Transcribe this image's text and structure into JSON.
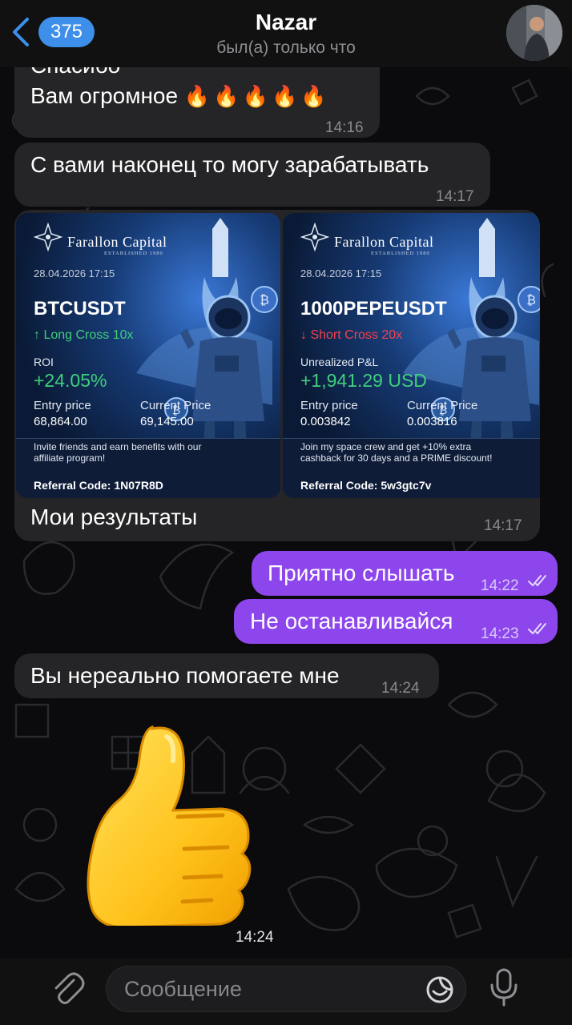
{
  "header": {
    "back_count": "375",
    "name": "Nazar",
    "status": "был(а) только что"
  },
  "messages": [
    {
      "id": "m1",
      "direction": "incoming",
      "text_cut": "Спасибо",
      "text": "Вам огромное",
      "emoji": "🔥🔥🔥🔥🔥",
      "time": "14:16"
    },
    {
      "id": "m2",
      "direction": "incoming",
      "text": "С вами наконец то могу зарабатывать",
      "time": "14:17"
    },
    {
      "id": "m3",
      "direction": "incoming",
      "text": "Мои результаты",
      "time": "14:17"
    },
    {
      "id": "m4",
      "direction": "outgoing",
      "text": "Приятно слышать",
      "time": "14:22",
      "read": true
    },
    {
      "id": "m5",
      "direction": "outgoing",
      "text": "Не останавливайся",
      "time": "14:23",
      "read": true
    },
    {
      "id": "m6",
      "direction": "incoming",
      "text": "Вы нереально помогаете мне",
      "time": "14:24"
    },
    {
      "id": "m7",
      "direction": "incoming",
      "emoji": "👍",
      "time": "14:24"
    }
  ],
  "cards": [
    {
      "brand": "Farallon Capital",
      "brand_sub": "ESTABLISHED 1980",
      "date": "28.04.2026 17:15",
      "symbol": "BTCUSDT",
      "direction": "↑ Long   Cross 10x",
      "direction_color": "#3fcf7b",
      "metric_label": "ROI",
      "metric_value": "+24.05%",
      "entry_label": "Entry price",
      "entry_value": "68,864.00",
      "current_label": "Current Price",
      "current_value": "69,145.00",
      "footer": "Invite friends and earn benefits with our affiliate program!",
      "referral": "Referral Code: 1N07R8D"
    },
    {
      "brand": "Farallon Capital",
      "brand_sub": "ESTABLISHED 1980",
      "date": "28.04.2026 17:15",
      "symbol": "1000PEPEUSDT",
      "direction": "↓ Short   Cross 20x",
      "direction_color": "#f0424e",
      "metric_label": "Unrealized P&L",
      "metric_value": "+1,941.29 USD",
      "entry_label": "Entry price",
      "entry_value": "0.003842",
      "current_label": "Current Price",
      "current_value": "0.003816",
      "footer": "Join my space crew and get +10% extra cashback for 30 days and a PRIME discount!",
      "referral": "Referral Code: 5w3gtc7v"
    }
  ],
  "input": {
    "placeholder": "Сообщение"
  },
  "colors": {
    "incoming_bubble": "#252527",
    "outgoing_bubble": "#8d46ec",
    "accent": "#3d8fea",
    "profit": "#3fcf7b",
    "loss": "#f0424e"
  },
  "icons": [
    "chevron-left-icon",
    "paperclip-icon",
    "sticker-icon",
    "microphone-icon",
    "double-check-icon",
    "compass-rose-icon"
  ]
}
